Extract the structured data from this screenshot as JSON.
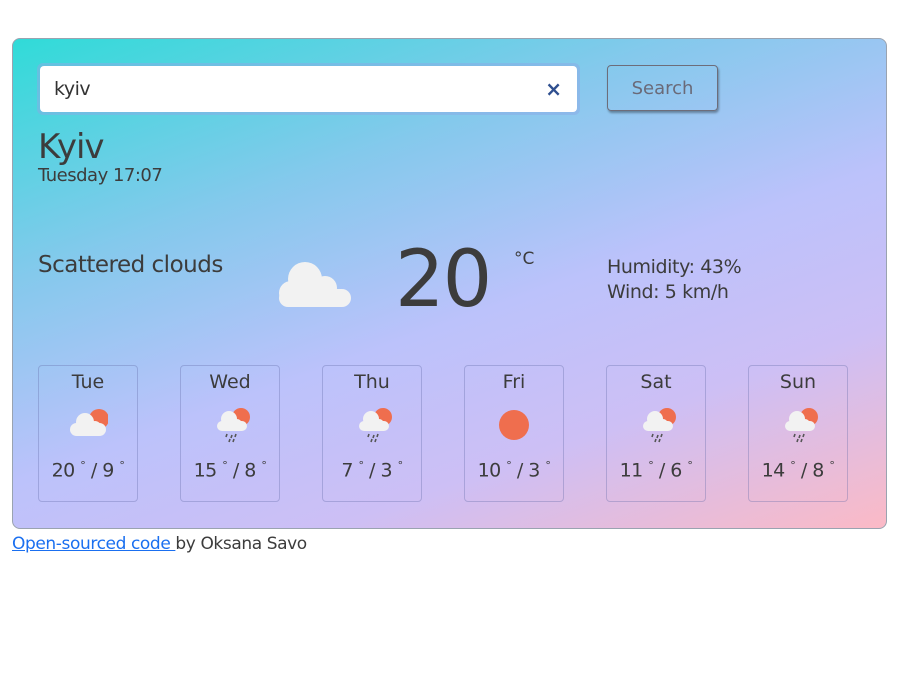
{
  "search": {
    "value": "kyiv",
    "clear_icon": "×",
    "button": "Search"
  },
  "current": {
    "city": "Kyiv",
    "datetime": "Tuesday 17:07",
    "description": "Scattered clouds",
    "icon": "cloud",
    "temperature": "20",
    "unit": "°C",
    "humidity": "Humidity: 43%",
    "wind": "Wind: 5 km/h"
  },
  "forecast": [
    {
      "day": "Tue",
      "icon": "partly-cloudy",
      "max": "20",
      "min": "9"
    },
    {
      "day": "Wed",
      "icon": "rain-sun",
      "max": "15",
      "min": "8"
    },
    {
      "day": "Thu",
      "icon": "rain-sun",
      "max": "7",
      "min": "3"
    },
    {
      "day": "Fri",
      "icon": "sun",
      "max": "10",
      "min": "3"
    },
    {
      "day": "Sat",
      "icon": "rain-sun",
      "max": "11",
      "min": "6"
    },
    {
      "day": "Sun",
      "icon": "rain-sun",
      "max": "14",
      "min": "8"
    }
  ],
  "footer": {
    "link": "Open-sourced code ",
    "author": "by Oksana Savo"
  },
  "colors": {
    "sun": "#ef6e4e",
    "cloud": "#f2f2f2",
    "link": "#1a6ff0"
  }
}
